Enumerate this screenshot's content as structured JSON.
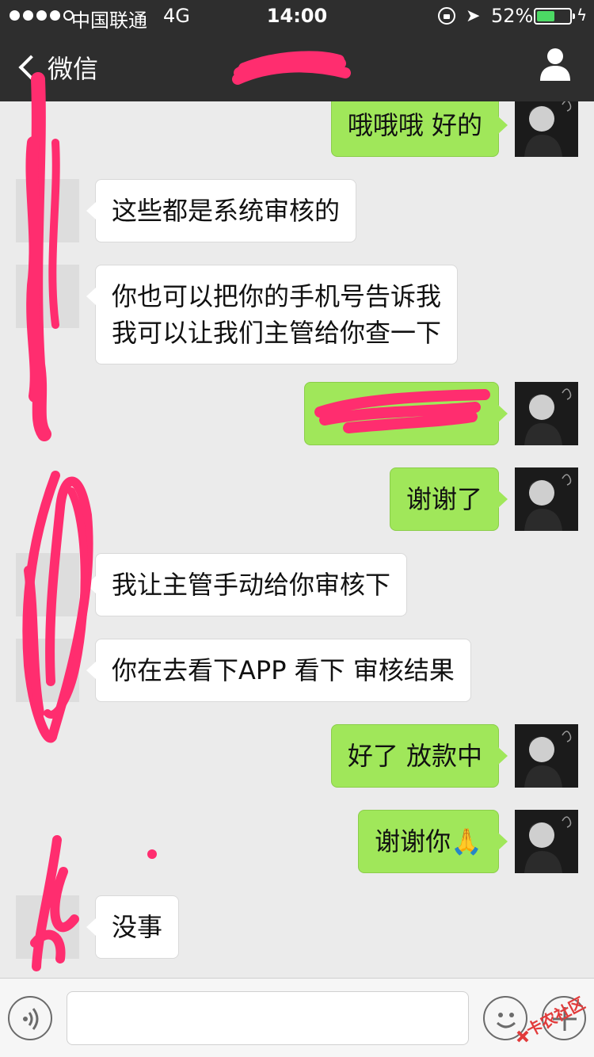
{
  "status": {
    "carrier": "中国联通",
    "network": "4G",
    "time": "14:00",
    "battery": "52%",
    "battery_level": 0.52
  },
  "nav": {
    "back_label": "微信",
    "title": ""
  },
  "messages": [
    {
      "side": "right",
      "text": "哦哦哦 好的"
    },
    {
      "side": "left",
      "text": "这些都是系统审核的"
    },
    {
      "side": "left",
      "text": "你也可以把你的手机号告诉我\n我可以让我们主管给你查一下"
    },
    {
      "side": "right",
      "text": ""
    },
    {
      "side": "right",
      "text": "谢谢了"
    },
    {
      "side": "left",
      "text": "我让主管手动给你审核下"
    },
    {
      "side": "left",
      "text": "你在去看下APP 看下 审核结果"
    },
    {
      "side": "right",
      "text": "好了 放款中"
    },
    {
      "side": "right",
      "text": "谢谢你🙏"
    },
    {
      "side": "left",
      "text": "没事"
    }
  ],
  "input": {
    "placeholder": ""
  },
  "watermark": {
    "text": "卡农社区"
  },
  "colors": {
    "nav_bg": "#2e2e2e",
    "chat_bg": "#ebebeb",
    "bubble_sent": "#a0e75a",
    "bubble_received": "#ffffff",
    "scribble": "#ff2d6f"
  }
}
